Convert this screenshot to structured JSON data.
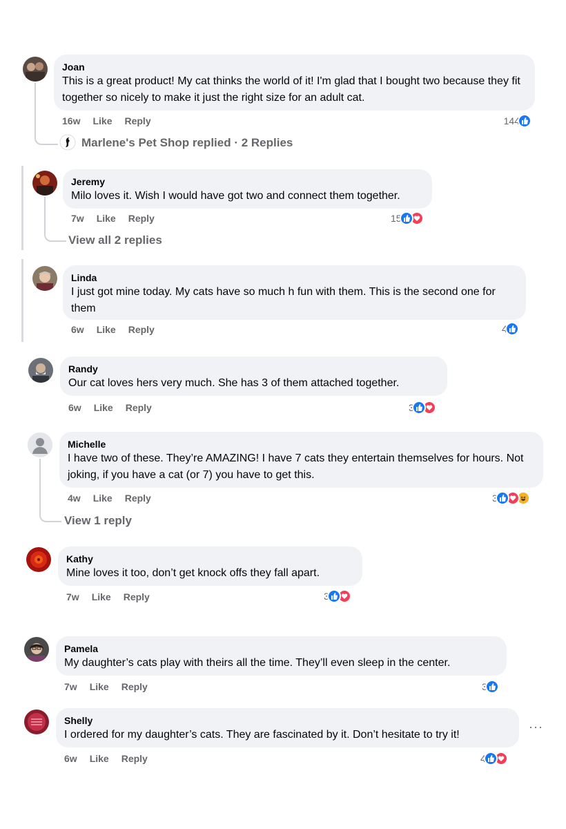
{
  "comments": [
    {
      "name": "Joan",
      "text": "This is a great product! My cat thinks the world of it! I'm glad that I bought two because they fit together so nicely to make it just the right size for an adult cat.",
      "time": "16w",
      "like": "Like",
      "reply": "Reply",
      "count": "144",
      "reactions": [
        "like"
      ]
    },
    {
      "name": "Jeremy",
      "text": "Milo loves it. Wish I would have got two and connect them together.",
      "time": "7w",
      "like": "Like",
      "reply": "Reply",
      "count": "15",
      "reactions": [
        "like",
        "love"
      ]
    },
    {
      "name": "Linda",
      "text": "I just got mine today. My cats have so much h fun with them. This is the second one for them",
      "time": "6w",
      "like": "Like",
      "reply": "Reply",
      "count": "4",
      "reactions": [
        "like"
      ]
    },
    {
      "name": "Randy",
      "text": "Our cat loves hers very much. She has 3 of them attached together.",
      "time": "6w",
      "like": "Like",
      "reply": "Reply",
      "count": "3",
      "reactions": [
        "like",
        "love"
      ]
    },
    {
      "name": "Michelle",
      "text": "I have two of these. They’re AMAZING! I have 7 cats they entertain themselves for hours. Not joking, if you have a cat (or 7) you have to get this.",
      "time": "4w",
      "like": "Like",
      "reply": "Reply",
      "count": "3",
      "reactions": [
        "like",
        "love",
        "haha"
      ]
    },
    {
      "name": "Kathy",
      "text": "Mine loves it too, don’t get knock offs they fall apart.",
      "time": "7w",
      "like": "Like",
      "reply": "Reply",
      "count": "3",
      "reactions": [
        "like",
        "love"
      ]
    },
    {
      "name": "Pamela",
      "text": "My daughter’s cats play with theirs all the time. They’ll even sleep in the center.",
      "time": "7w",
      "like": "Like",
      "reply": "Reply",
      "count": "3",
      "reactions": [
        "like"
      ]
    },
    {
      "name": "Shelly",
      "text": "I ordered for my daughter’s cats. They are fascinated by it. Don’t hesitate to try it!",
      "time": "6w",
      "like": "Like",
      "reply": "Reply",
      "count": "4",
      "reactions": [
        "like",
        "love"
      ]
    }
  ],
  "replies": {
    "joan": "Marlene's Pet Shop replied · 2 Replies",
    "jeremy": "View all 2 replies",
    "michelle": "View 1 reply"
  },
  "more_options": "···",
  "colors": {
    "like": "#1877f2",
    "love": "#f33e58",
    "haha": "#f7b125",
    "bubble": "#f0f2f5",
    "meta": "#65676b"
  },
  "icons": {
    "like": "thumbs-up-icon",
    "love": "heart-icon",
    "haha": "laughing-face-icon",
    "page": "shop-logo-icon",
    "avatar_default": "default-avatar-icon"
  }
}
